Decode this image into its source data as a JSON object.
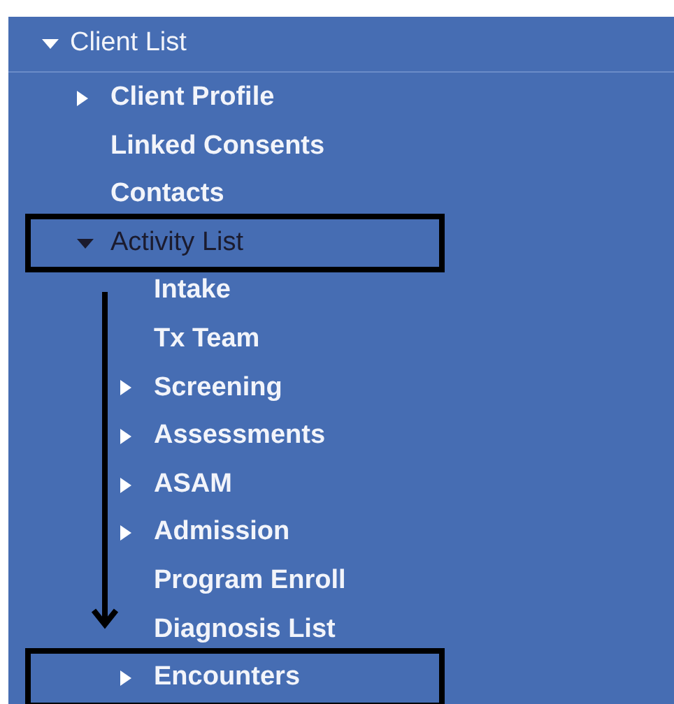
{
  "tree": {
    "label": "Client List",
    "expanded": true,
    "children": [
      {
        "label": "Client Profile",
        "kind": "branch",
        "expanded": false,
        "selected": false,
        "highlighted": false
      },
      {
        "label": "Linked Consents",
        "kind": "leaf",
        "selected": false,
        "highlighted": false
      },
      {
        "label": "Contacts",
        "kind": "leaf",
        "selected": false,
        "highlighted": false
      },
      {
        "label": "Activity List",
        "kind": "branch",
        "expanded": true,
        "selected": true,
        "highlighted": true,
        "children": [
          {
            "label": "Intake",
            "kind": "leaf",
            "selected": false,
            "highlighted": false
          },
          {
            "label": "Tx Team",
            "kind": "leaf",
            "selected": false,
            "highlighted": false
          },
          {
            "label": "Screening",
            "kind": "branch",
            "expanded": false,
            "selected": false,
            "highlighted": false
          },
          {
            "label": "Assessments",
            "kind": "branch",
            "expanded": false,
            "selected": false,
            "highlighted": false
          },
          {
            "label": "ASAM",
            "kind": "branch",
            "expanded": false,
            "selected": false,
            "highlighted": false
          },
          {
            "label": "Admission",
            "kind": "branch",
            "expanded": false,
            "selected": false,
            "highlighted": false
          },
          {
            "label": "Program Enroll",
            "kind": "leaf",
            "selected": false,
            "highlighted": false
          },
          {
            "label": "Diagnosis List",
            "kind": "leaf",
            "selected": false,
            "highlighted": false
          },
          {
            "label": "Encounters",
            "kind": "branch",
            "expanded": false,
            "selected": false,
            "highlighted": true
          }
        ]
      }
    ]
  },
  "annotation": {
    "kind": "arrow"
  }
}
